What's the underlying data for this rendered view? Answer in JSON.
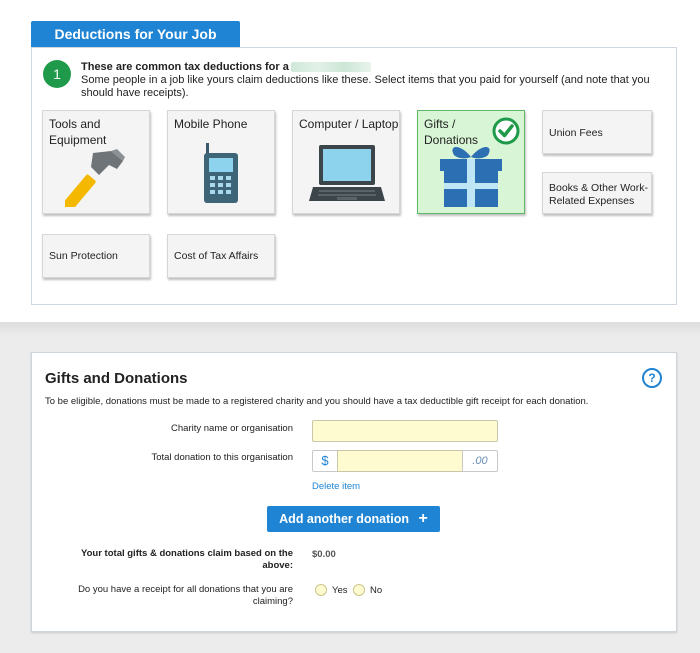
{
  "tab_title": "Deductions for Your Job",
  "step": {
    "number": "1",
    "heading": "These are common tax deductions for a",
    "body": "Some people in a job like yours claim deductions like these. Select items that you paid for yourself (and note that you should have receipts)."
  },
  "cards": [
    {
      "label": "Tools and Equipment",
      "icon": "hammer-icon",
      "selected": false
    },
    {
      "label": "Mobile Phone",
      "icon": "mobile-phone-icon",
      "selected": false
    },
    {
      "label": "Computer / Laptop",
      "icon": "laptop-icon",
      "selected": false
    },
    {
      "label": "Gifts / Donations",
      "icon": "gift-icon",
      "selected": true
    },
    {
      "label": "Union Fees",
      "selected": false
    },
    {
      "label": "Books & Other Work-Related Expenses",
      "selected": false
    },
    {
      "label": "Sun Protection",
      "selected": false
    },
    {
      "label": "Cost of Tax Affairs",
      "selected": false
    }
  ],
  "section": {
    "title": "Gifts and Donations",
    "help": "?",
    "description": "To be eligible, donations must be made to a registered charity and you should have a tax deductible gift receipt for each donation.",
    "charity_label": "Charity name or organisation",
    "total_donation_label": "Total donation to this organisation",
    "currency_symbol": "$",
    "cents_placeholder": ".00",
    "delete_link": "Delete item",
    "add_button": "Add another donation",
    "add_symbol": "+",
    "total_label": "Your total gifts & donations claim based on the above:",
    "total_value": "$0.00",
    "receipt_question": "Do you have a receipt for all donations that you are claiming?",
    "yes_label": "Yes",
    "no_label": "No"
  },
  "colors": {
    "accent_blue": "#1f84d3",
    "step_green": "#1f9a4a",
    "selected_card_bg": "#d8f6d6",
    "input_yellow": "#fffbd0"
  }
}
